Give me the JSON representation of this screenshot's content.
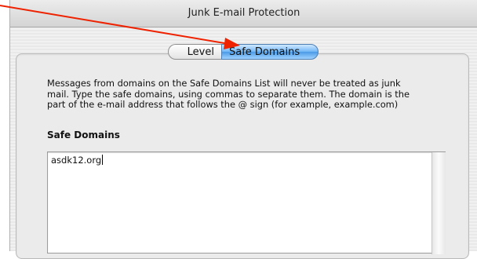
{
  "window": {
    "title": "Junk E-mail Protection"
  },
  "tabs": [
    {
      "label": "Level",
      "selected": false
    },
    {
      "label": "Safe Domains",
      "selected": true
    }
  ],
  "content": {
    "description": "Messages from domains on the Safe Domains List will never be treated as junk\nmail. Type the safe domains, using commas to separate them.  The domain is the\npart of the e-mail address that follows the @ sign (for example, example.com)",
    "section_label": "Safe Domains",
    "safe_domains_value": "asdk12.org"
  },
  "annotation": {
    "arrow_color": "#ee2200"
  }
}
